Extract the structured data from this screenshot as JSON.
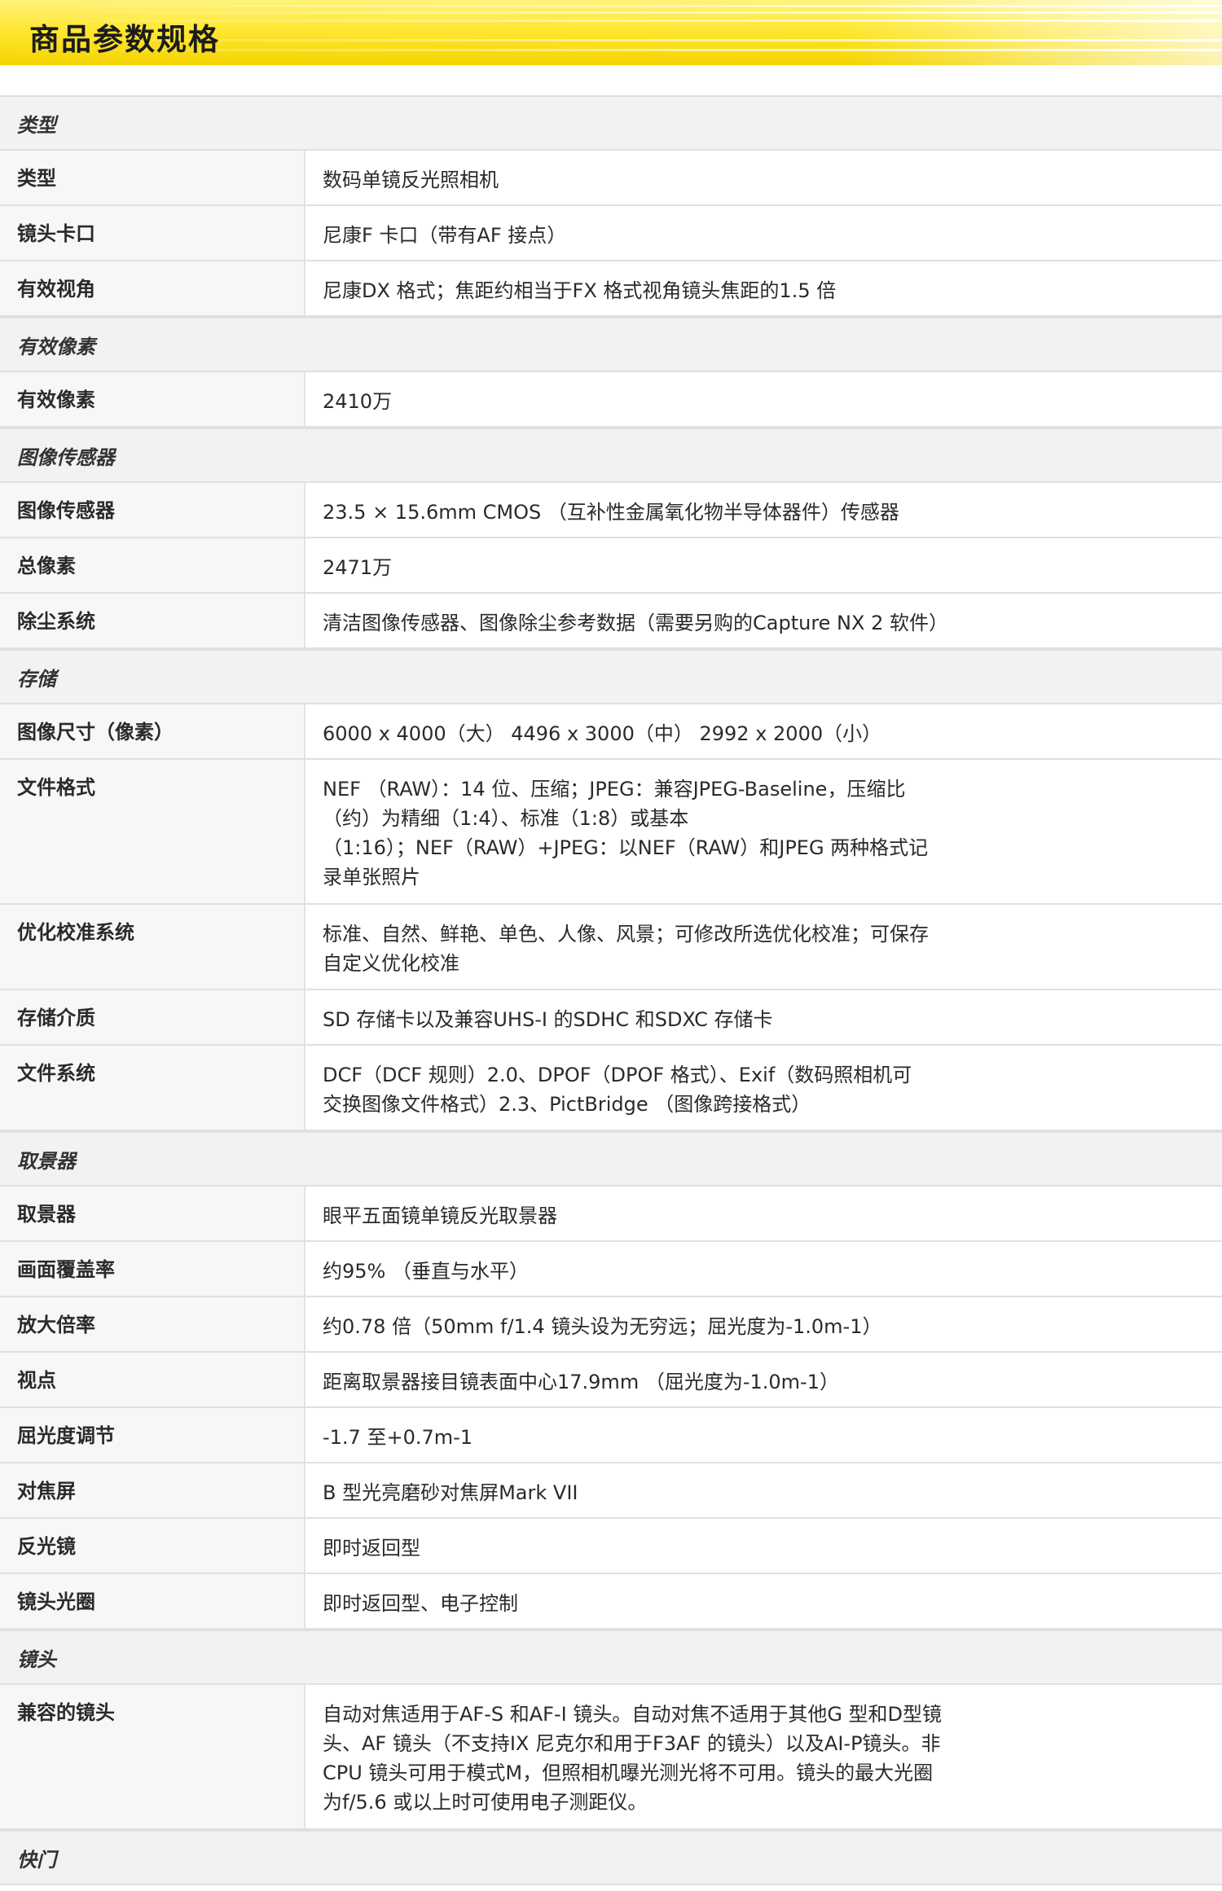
{
  "header": {
    "title": "商品参数规格"
  },
  "sections": [
    {
      "title": "类型",
      "rows": [
        {
          "label": "类型",
          "lines": [
            "数码单镜反光照相机"
          ]
        },
        {
          "label": "镜头卡口",
          "lines": [
            "尼康F 卡口（带有AF 接点）"
          ]
        },
        {
          "label": "有效视角",
          "lines": [
            "尼康DX 格式；焦距约相当于FX 格式视角镜头焦距的1.5 倍"
          ]
        }
      ]
    },
    {
      "title": "有效像素",
      "rows": [
        {
          "label": "有效像素",
          "lines": [
            "2410万"
          ]
        }
      ]
    },
    {
      "title": "图像传感器",
      "rows": [
        {
          "label": "图像传感器",
          "lines": [
            "23.5 × 15.6mm CMOS （互补性金属氧化物半导体器件）传感器"
          ]
        },
        {
          "label": "总像素",
          "lines": [
            "2471万"
          ]
        },
        {
          "label": "除尘系统",
          "lines": [
            "清洁图像传感器、图像除尘参考数据（需要另购的Capture NX 2 软件）"
          ]
        }
      ]
    },
    {
      "title": "存储",
      "rows": [
        {
          "label": "图像尺寸（像素）",
          "lines": [
            "6000 x 4000（大） 4496 x 3000（中） 2992 x 2000（小）"
          ]
        },
        {
          "label": "文件格式",
          "lines": [
            "NEF （RAW）：14 位、压缩；JPEG：兼容JPEG-Baseline，压缩比",
            "（约）为精细（1:4）、标准（1:8）或基本",
            "（1:16）；NEF（RAW）+JPEG：以NEF（RAW）和JPEG 两种格式记",
            "录单张照片"
          ]
        },
        {
          "label": "优化校准系统",
          "lines": [
            "标准、自然、鲜艳、单色、人像、风景；可修改所选优化校准；可保存",
            "自定义优化校准"
          ]
        },
        {
          "label": "存储介质",
          "lines": [
            "SD 存储卡以及兼容UHS-I 的SDHC 和SDXC 存储卡"
          ]
        },
        {
          "label": "文件系统",
          "lines": [
            "DCF（DCF 规则）2.0、DPOF（DPOF 格式）、Exif（数码照相机可",
            "交换图像文件格式）2.3、PictBridge （图像跨接格式）"
          ]
        }
      ]
    },
    {
      "title": "取景器",
      "rows": [
        {
          "label": "取景器",
          "lines": [
            "眼平五面镜单镜反光取景器"
          ]
        },
        {
          "label": "画面覆盖率",
          "lines": [
            "约95% （垂直与水平）"
          ]
        },
        {
          "label": "放大倍率",
          "lines": [
            "约0.78 倍（50mm f/1.4 镜头设为无穷远；屈光度为-1.0m-1）"
          ]
        },
        {
          "label": "视点",
          "lines": [
            "距离取景器接目镜表面中心17.9mm （屈光度为-1.0m-1）"
          ]
        },
        {
          "label": "屈光度调节",
          "lines": [
            "-1.7 至+0.7m-1"
          ]
        },
        {
          "label": "对焦屏",
          "lines": [
            "B 型光亮磨砂对焦屏Mark VII"
          ]
        },
        {
          "label": "反光镜",
          "lines": [
            "即时返回型"
          ]
        },
        {
          "label": "镜头光圈",
          "lines": [
            "即时返回型、电子控制"
          ]
        }
      ]
    },
    {
      "title": "镜头",
      "rows": [
        {
          "label": "兼容的镜头",
          "lines": [
            "自动对焦适用于AF-S 和AF-I 镜头。自动对焦不适用于其他G 型和D型镜",
            "头、AF 镜头（不支持IX 尼克尔和用于F3AF 的镜头）以及AI-P镜头。非",
            "CPU 镜头可用于模式M，但照相机曝光测光将不可用。镜头的最大光圈",
            "为f/5.6 或以上时可使用电子测距仪。"
          ]
        }
      ]
    },
    {
      "title": "快门",
      "rows": []
    }
  ]
}
